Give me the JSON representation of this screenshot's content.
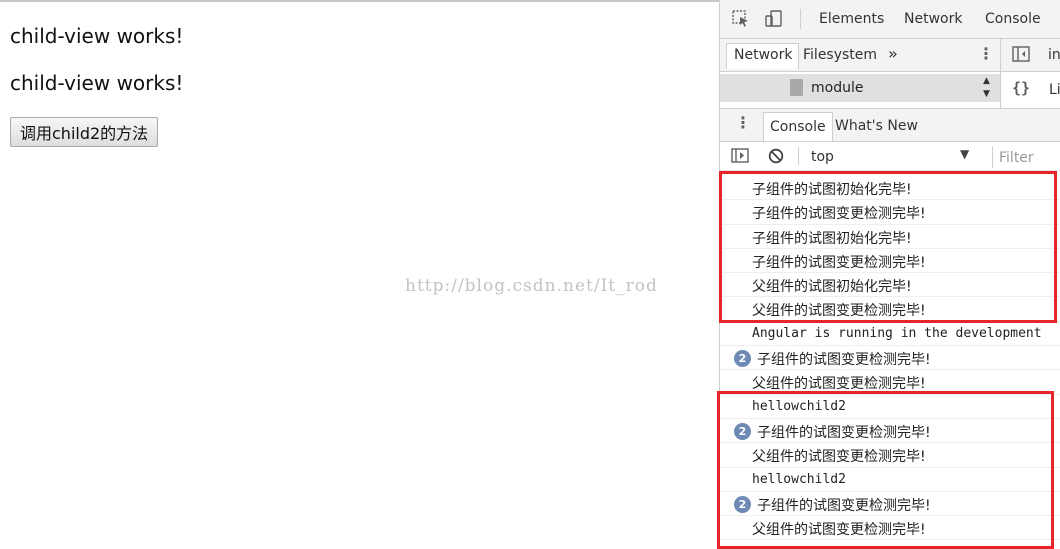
{
  "page": {
    "heading_1": "child-view works!",
    "heading_2": "child-view works!",
    "button_label": "调用child2的方法",
    "watermark": "http://blog.csdn.net/It_rod"
  },
  "devtools": {
    "main_tabs": [
      "Elements",
      "Network",
      "Console"
    ],
    "clipped_right_label_1": "in",
    "clipped_right_label_2": "Li",
    "nav_tabs": {
      "active": "Network",
      "second": "Filesystem",
      "more": "»"
    },
    "file_item": "module",
    "console_tabs": {
      "active": "Console",
      "second": "What's New"
    },
    "context": "top",
    "filter_placeholder": "Filter",
    "logs": [
      {
        "text": "子组件的试图初始化完毕!",
        "count": null,
        "mono": false
      },
      {
        "text": "子组件的试图变更检测完毕!",
        "count": null,
        "mono": false
      },
      {
        "text": "子组件的试图初始化完毕!",
        "count": null,
        "mono": false
      },
      {
        "text": "子组件的试图变更检测完毕!",
        "count": null,
        "mono": false
      },
      {
        "text": "父组件的试图初始化完毕!",
        "count": null,
        "mono": false
      },
      {
        "text": "父组件的试图变更检测完毕!",
        "count": null,
        "mono": false
      },
      {
        "text": "Angular is running in the development",
        "count": null,
        "mono": true
      },
      {
        "text": "子组件的试图变更检测完毕!",
        "count": "2",
        "mono": false
      },
      {
        "text": "父组件的试图变更检测完毕!",
        "count": null,
        "mono": false
      },
      {
        "text": "hellowchild2",
        "count": null,
        "mono": true
      },
      {
        "text": "子组件的试图变更检测完毕!",
        "count": "2",
        "mono": false
      },
      {
        "text": "父组件的试图变更检测完毕!",
        "count": null,
        "mono": false
      },
      {
        "text": "hellowchild2",
        "count": null,
        "mono": true
      },
      {
        "text": "子组件的试图变更检测完毕!",
        "count": "2",
        "mono": false
      },
      {
        "text": "父组件的试图变更检测完毕!",
        "count": null,
        "mono": false
      }
    ]
  },
  "colors": {
    "highlight": "#e8232b",
    "badge": "#6e89b3"
  }
}
